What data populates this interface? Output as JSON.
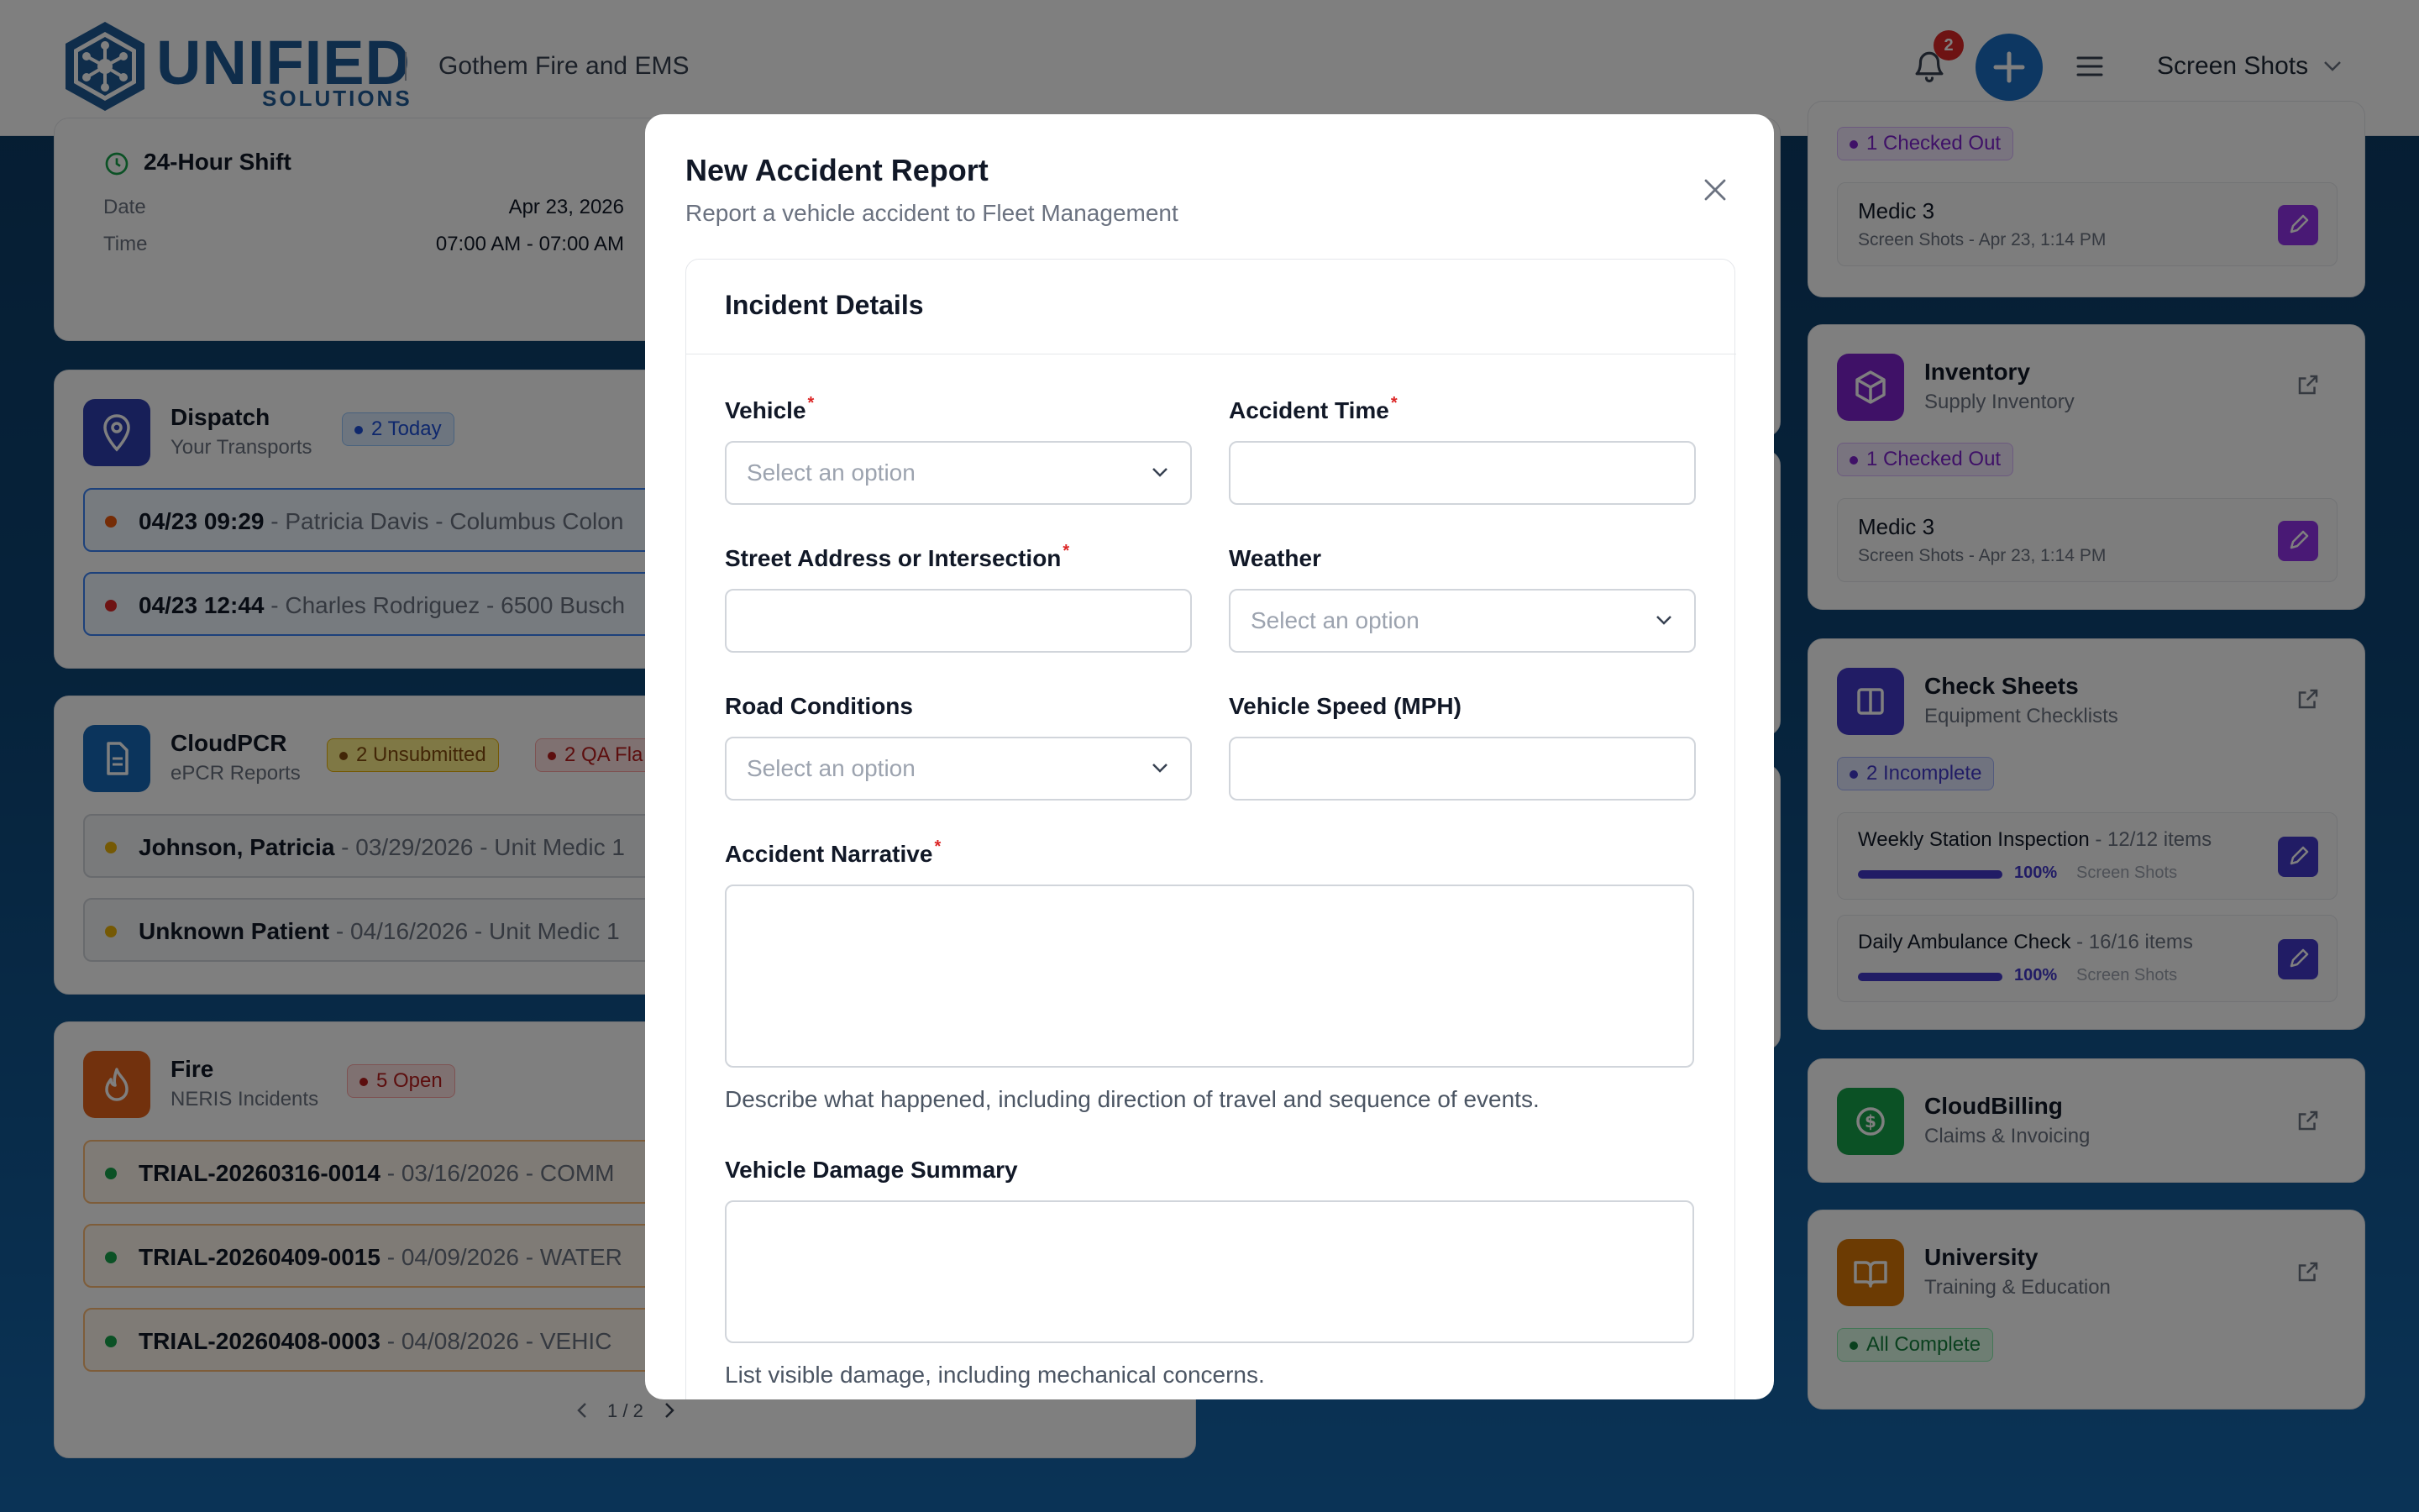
{
  "header": {
    "logo_text": "UNIFIED",
    "logo_sub": "SOLUTIONS",
    "org_name": "Gothem Fire and EMS",
    "notification_count": "2",
    "user_menu_label": "Screen Shots"
  },
  "shift": {
    "title": "24-Hour Shift",
    "date_label": "Date",
    "date_value": "Apr 23, 2026",
    "time_label": "Time",
    "time_value": "07:00 AM - 07:00 AM"
  },
  "dispatch": {
    "title": "Dispatch",
    "subtitle": "Your Transports",
    "badge": "2 Today",
    "rows": [
      {
        "time": "04/23 09:29",
        "detail": " - Patricia Davis - Columbus Colon"
      },
      {
        "time": "04/23 12:44",
        "detail": " - Charles Rodriguez - 6500 Busch"
      }
    ]
  },
  "cloudpcr": {
    "title": "CloudPCR",
    "subtitle": "ePCR Reports",
    "badge_unsubmitted": "2 Unsubmitted",
    "badge_qa": "2 QA Fla",
    "rows": [
      {
        "name": "Johnson, Patricia",
        "detail": " - 03/29/2026 - Unit Medic 1"
      },
      {
        "name": "Unknown Patient",
        "detail": " - 04/16/2026 - Unit Medic 1"
      }
    ]
  },
  "fire": {
    "title": "Fire",
    "subtitle": "NERIS Incidents",
    "badge": "5 Open",
    "rows": [
      {
        "id": "TRIAL-20260316-0014",
        "detail": " - 03/16/2026 - COMM"
      },
      {
        "id": "TRIAL-20260409-0015",
        "detail": " - 04/09/2026 - WATER"
      },
      {
        "id": "TRIAL-20260408-0003",
        "detail": " - 04/08/2026 - VEHIC"
      }
    ],
    "pagination": "1 / 2"
  },
  "right_top": {
    "badge": "1 Checked Out",
    "item_title": "Medic 3",
    "item_meta": "Screen Shots - Apr 23, 1:14 PM"
  },
  "inventory": {
    "title": "Inventory",
    "subtitle": "Supply Inventory",
    "badge": "1 Checked Out",
    "item_title": "Medic 3",
    "item_meta": "Screen Shots - Apr 23, 1:14 PM"
  },
  "checksheets": {
    "title": "Check Sheets",
    "subtitle": "Equipment Checklists",
    "badge": "2 Incomplete",
    "items": [
      {
        "title": "Weekly Station Inspection",
        "count": " - 12/12 items",
        "percent": "100%",
        "owner": "Screen Shots",
        "progress": 1.0
      },
      {
        "title": "Daily Ambulance Check",
        "count": " - 16/16 items",
        "percent": "100%",
        "owner": "Screen Shots",
        "progress": 1.0
      }
    ]
  },
  "cloudbilling": {
    "title": "CloudBilling",
    "subtitle": "Claims & Invoicing"
  },
  "university": {
    "title": "University",
    "subtitle": "Training & Education",
    "badge": "All Complete"
  },
  "modal": {
    "title": "New Accident Report",
    "subtitle": "Report a vehicle accident to Fleet Management",
    "section_title": "Incident Details",
    "vehicle_label": "Vehicle",
    "vehicle_placeholder": "Select an option",
    "accident_time_label": "Accident Time",
    "accident_time_value": "",
    "street_label": "Street Address or Intersection",
    "street_value": "",
    "weather_label": "Weather",
    "weather_placeholder": "Select an option",
    "road_label": "Road Conditions",
    "road_placeholder": "Select an option",
    "speed_label": "Vehicle Speed (MPH)",
    "speed_value": "",
    "narrative_label": "Accident Narrative",
    "narrative_value": "",
    "narrative_help": "Describe what happened, including direction of travel and sequence of events.",
    "damage_label": "Vehicle Damage Summary",
    "damage_value": "",
    "damage_help": "List visible damage, including mechanical concerns.",
    "required_marker": "*"
  },
  "colors": {
    "brand_blue": "#1f5a96",
    "accent_blue": "#1a6fc4",
    "dispatch": "#2f3fb0",
    "cloudpcr": "#1668b8",
    "fire": "#e5621a",
    "inventory": "#7e22ce",
    "checksheets": "#4338ca",
    "cloudbilling": "#16a34a",
    "university": "#d97706",
    "danger": "#dc2626"
  }
}
